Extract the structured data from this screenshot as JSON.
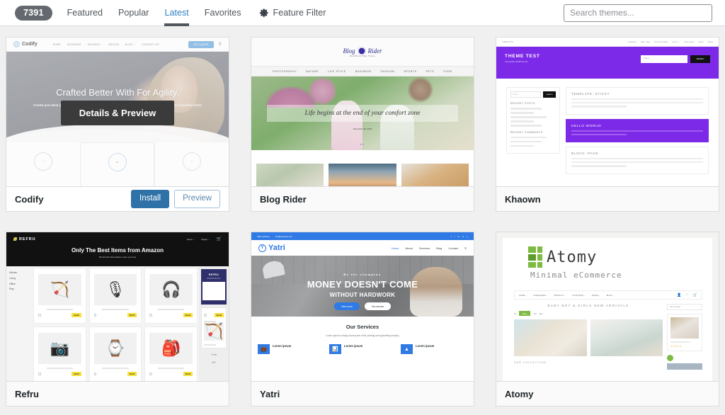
{
  "filter_bar": {
    "theme_count": "7391",
    "tabs": [
      {
        "label": "Featured",
        "active": false
      },
      {
        "label": "Popular",
        "active": false
      },
      {
        "label": "Latest",
        "active": true
      },
      {
        "label": "Favorites",
        "active": false
      },
      {
        "label": "Feature Filter",
        "active": false,
        "icon": "gear-icon"
      }
    ],
    "search": {
      "placeholder": "Search themes...",
      "value": ""
    }
  },
  "actions": {
    "details_preview": "Details & Preview",
    "install": "Install",
    "preview": "Preview"
  },
  "themes": [
    {
      "name": "Codify",
      "hovered": true,
      "mock": {
        "logo": "Codify",
        "menu": [
          "HOME",
          "BUSINESS",
          "SIDEBAR ~",
          "DESIGN",
          "BLOG ~",
          "CONTACT US"
        ],
        "cta": "GET A QUOTE",
        "search_icon": "search-icon",
        "headline": "Crafted Better With For Agility.",
        "subtext": "Create just what you need for your Perfect Website. Choose from a wide range of Elements & simplified them as your own Content.",
        "features": [
          "layers-icon",
          "gear-icon",
          "star-icon"
        ]
      }
    },
    {
      "name": "Blog Rider",
      "hovered": false,
      "mock": {
        "logo": "Blog Rider",
        "tagline": "WordPress Blog Theme",
        "menu": [
          "PHOTOGRAPHY",
          "NATURE",
          "LIFE STYLE",
          "BUSINESS",
          "FASHION",
          "SPORTS",
          "PETS",
          "FOOD"
        ],
        "quote": "Life begins at the end of your comfort zone",
        "date": "December 28, 2020"
      }
    },
    {
      "name": "Khaown",
      "hovered": false,
      "mock": {
        "topbar_left": "THEME TEST",
        "topnav": [
          "Categories",
          "Tags / Tags",
          "Posts Formatted",
          "Level 1 ~",
          "Lorem Ipsum",
          "About",
          "Pages"
        ],
        "banner_title": "THEME TEST",
        "banner_sub": "Just another WordPress site",
        "search_placeholder": "Search",
        "search_button": "SEARCH",
        "widget_search_placeholder": "Search",
        "widget_search_button": "SEARCH",
        "widget_titles": [
          "RECENT POSTS",
          "RECENT COMMENTS"
        ],
        "posts": [
          {
            "title": "TEMPLATE: STICKY",
            "highlight": false
          },
          {
            "title": "HELLO WORLD!",
            "highlight": true
          },
          {
            "title": "BLOCK: PAGE",
            "highlight": false
          }
        ],
        "accent_color": "#7d2ae8"
      }
    },
    {
      "name": "Refru",
      "hovered": false,
      "mock": {
        "logo": "REFRU",
        "nav": [
          "Home ~",
          "Pages ~"
        ],
        "cart_icon": "cart-icon",
        "headline": "Only The Best Items from Amazon",
        "subtext": "We find the best deals to save you time",
        "categories": [
          "Kitchen",
          "Living",
          "Office",
          "Play"
        ],
        "badges": [
          "$19.99",
          "Reviews",
          "$22.00",
          "$19.99"
        ],
        "promo_title": "REFRU",
        "promo_sub": "WORDPRESS",
        "accent_color": "#f7e03d"
      }
    },
    {
      "name": "Yatri",
      "hovered": false,
      "mock": {
        "topbar": [
          "Office address",
          "info@example.com"
        ],
        "social": [
          "f",
          "t",
          "G",
          "in",
          "o"
        ],
        "logo": "Yatri",
        "menu": [
          "Home",
          "About",
          "Services",
          "Blog",
          "Contact"
        ],
        "search_icon": "search-icon",
        "kicker": "Be the champion",
        "headline": "MONEY DOESN'T COME",
        "subheadline": "WITHOUT HARDWORK",
        "btn_primary": "View more",
        "btn_secondary": "Our service",
        "services_title": "Our Services",
        "services_sub": "Lorem ipsum is simply dummy text of the printing and typesetting industry",
        "service_cards": [
          "Lorem ipsum",
          "Lorem ipsum",
          "Lorem ipsum"
        ],
        "accent_color": "#2f7ae5"
      }
    },
    {
      "name": "Atomy",
      "hovered": false,
      "mock": {
        "logo": "Atomy",
        "slogan": "Minimal eCommerce",
        "nav": [
          "HOME ~",
          "CATEGORIES ~",
          "PRODUCT ~",
          "YOUR SHOP ~",
          "PAGES ~",
          "BLOG ~"
        ],
        "icons": [
          "user-icon",
          "heart-icon",
          "cart-icon"
        ],
        "section_title": "BABY BOY & GIRLS NEW ARRIVALS",
        "filters": [
          "All",
          "Baby",
          "Girl",
          "Boy"
        ],
        "collection_title": "OUR COLLECTION",
        "sidebar_select": "Sort by latest",
        "product_name": "Pink Shoes",
        "accent_color": "#7dbb42"
      }
    }
  ]
}
